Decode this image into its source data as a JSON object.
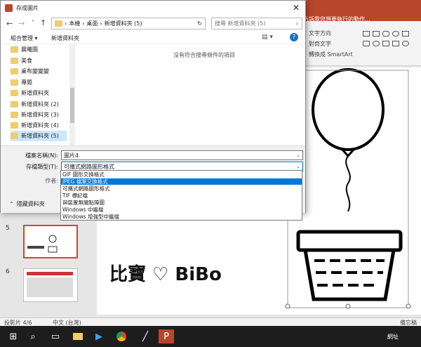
{
  "powerpoint": {
    "tell_me": "告訴我您想要執行的動作...",
    "ribbon_text_direction": "文字方向",
    "ribbon_align_text": "對齊文字",
    "ribbon_smartart": "轉換成 SmartArt",
    "thumbnails": [
      {
        "number": "5",
        "selected": true
      },
      {
        "number": "6",
        "selected": false
      }
    ],
    "slide_caption": "比寶 ♡ BiBo",
    "status_slide": "投影片 4/6",
    "status_language": "中文 (台灣)",
    "status_notes": "備忘稿"
  },
  "dialog": {
    "title": "存成圖片",
    "address_path": [
      "本機",
      "桌面",
      "新增資料夾 (5)"
    ],
    "search_placeholder": "搜尋 新增資料夾 (5)",
    "organize_label": "組合管理 ▾",
    "new_folder_label": "新增資料夾",
    "help_icon": "?",
    "empty_message": "沒有符合搜尋條件的項目",
    "tree_items": [
      {
        "label": "晨曦園",
        "selected": false
      },
      {
        "label": "美食",
        "selected": false
      },
      {
        "label": "桌布變變變",
        "selected": false
      },
      {
        "label": "專題",
        "selected": false
      },
      {
        "label": "新增資料夾",
        "selected": false
      },
      {
        "label": "新增資料夾 (2)",
        "selected": false
      },
      {
        "label": "新增資料夾 (3)",
        "selected": false
      },
      {
        "label": "新增資料夾 (4)",
        "selected": false
      },
      {
        "label": "新增資料夾 (5)",
        "selected": true
      }
    ],
    "filename_label": "檔案名稱(N):",
    "filename_value": "圖片4",
    "filetype_label": "存檔類型(T):",
    "filetype_value": "可攜式網路圖形格式",
    "author_label": "作者:",
    "hide_folders_label": "隱藏資料夾",
    "filetype_options": [
      {
        "label": "GIF 圖形交換格式",
        "highlighted": false
      },
      {
        "label": "JPEG 檔案交換格式",
        "highlighted": true
      },
      {
        "label": "可攜式網路圖形格式",
        "highlighted": false
      },
      {
        "label": "TIF 標記檔",
        "highlighted": false
      },
      {
        "label": "與裝置無關點陣圖",
        "highlighted": false
      },
      {
        "label": "Windows 中繼檔",
        "highlighted": false
      },
      {
        "label": "Windows 增強型中繼檔",
        "highlighted": false
      }
    ]
  },
  "taskbar": {
    "network_label": "網址"
  },
  "colors": {
    "powerpoint_accent": "#b7472a",
    "selection_blue": "#0078d7",
    "folder_yellow": "#f2cc6b"
  }
}
